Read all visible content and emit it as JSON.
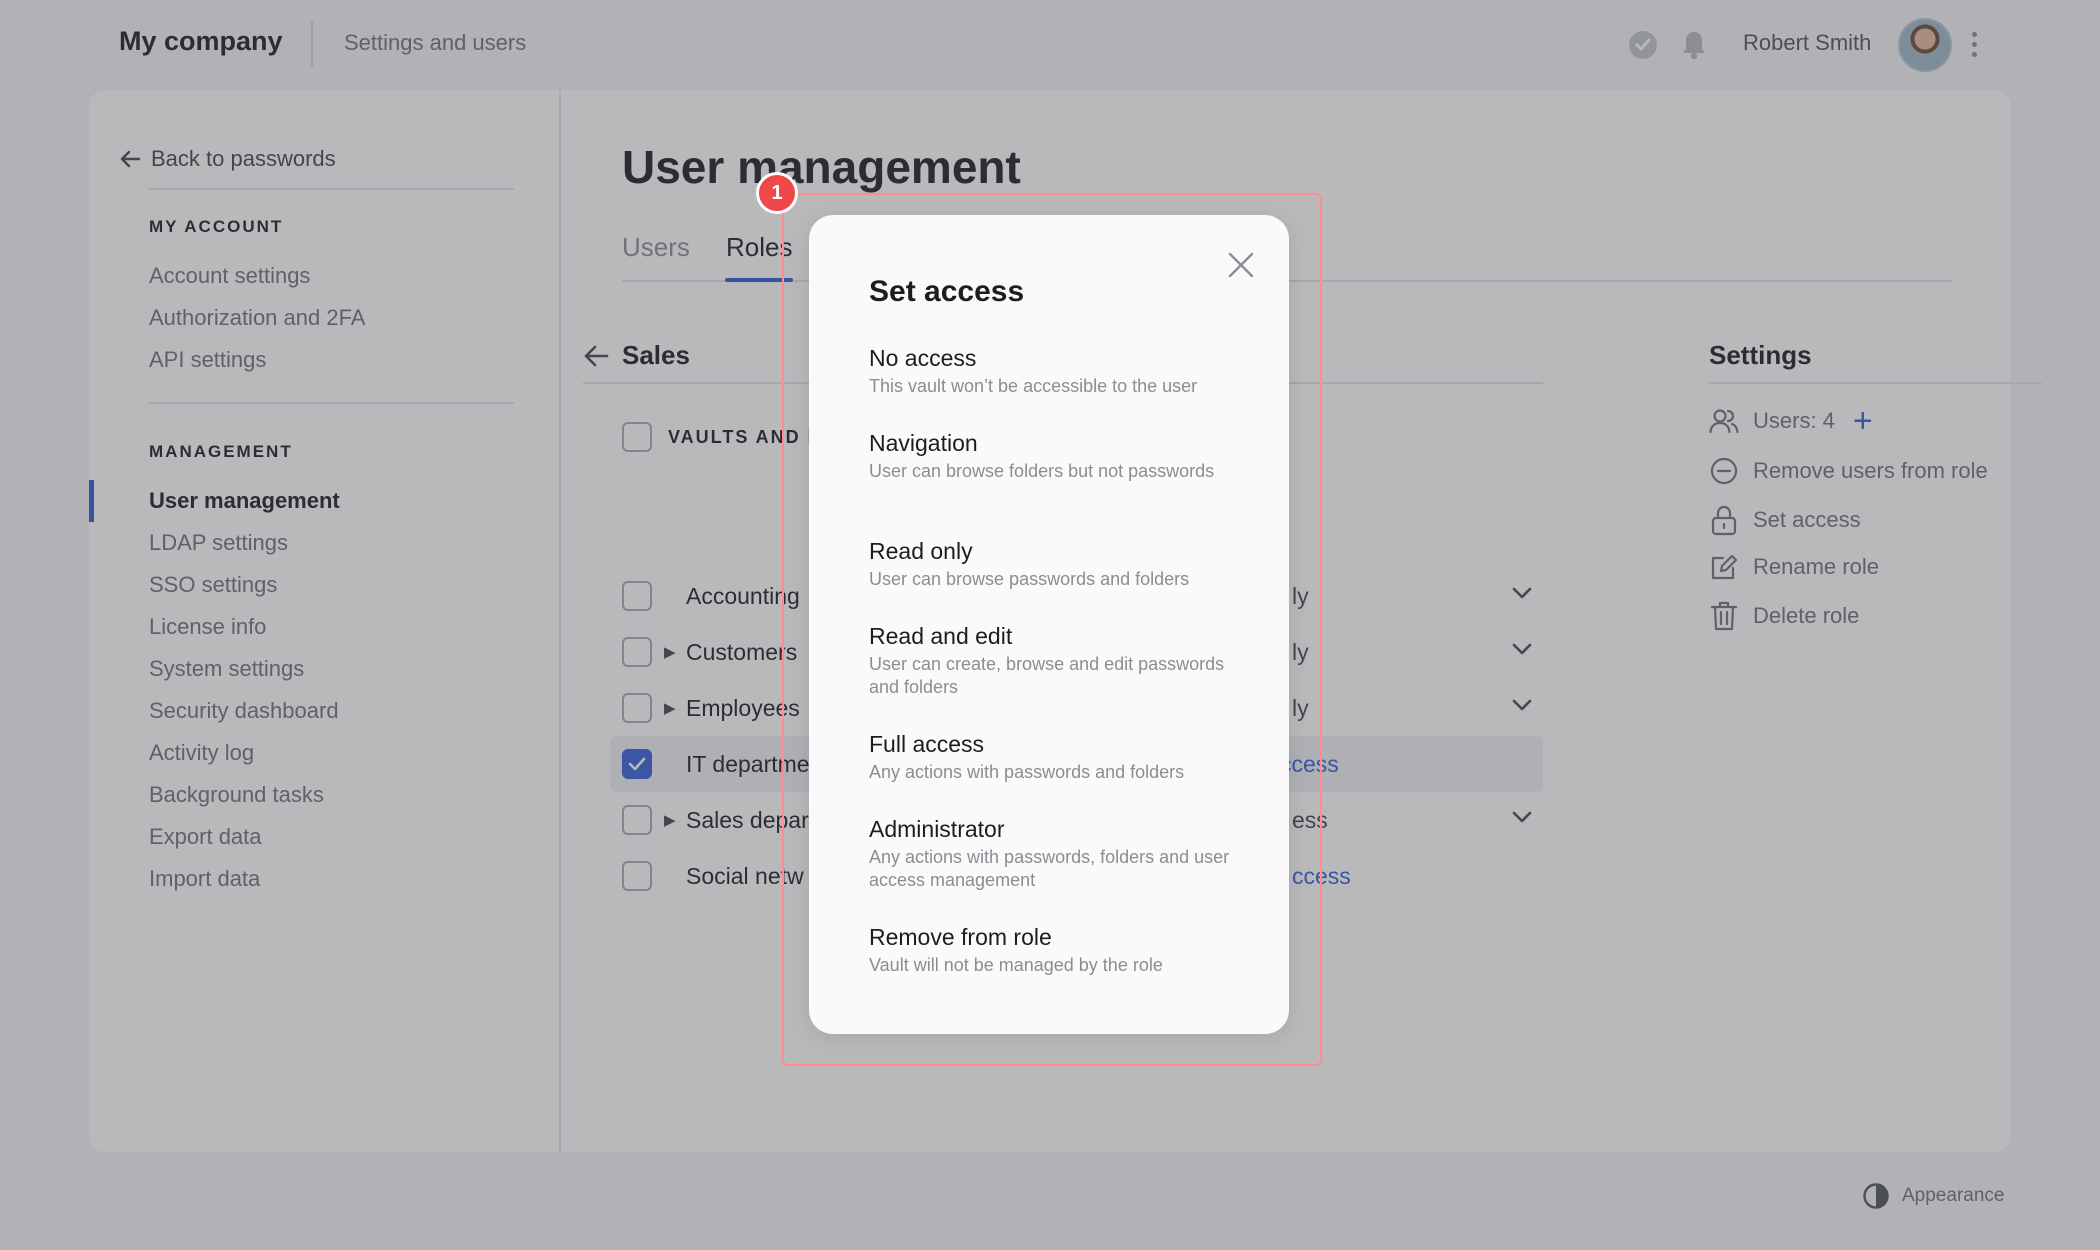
{
  "header": {
    "brand": "My company",
    "breadcrumb": "Settings and users",
    "user_name": "Robert Smith"
  },
  "sidebar": {
    "back_label": "Back to passwords",
    "my_account": {
      "heading": "MY ACCOUNT",
      "items": [
        "Account settings",
        "Authorization and 2FA",
        "API settings"
      ]
    },
    "management": {
      "heading": "MANAGEMENT",
      "items": [
        "User management",
        "LDAP settings",
        "SSO settings",
        "License info",
        "System settings",
        "Security dashboard",
        "Activity log",
        "Background tasks",
        "Export data",
        "Import data"
      ],
      "active": "User management"
    }
  },
  "main": {
    "title": "User management",
    "tabs": [
      "Users",
      "Roles"
    ],
    "active_tab": "Roles",
    "role_name": "Sales",
    "vaults_heading": "VAULTS AND I",
    "vaults": [
      {
        "name": "Accounting",
        "access": "ly",
        "expandable": false,
        "checked": false,
        "link": false,
        "dropdown": true
      },
      {
        "name": "Customers",
        "access": "ly",
        "expandable": true,
        "checked": false,
        "link": false,
        "dropdown": true
      },
      {
        "name": "Employees",
        "access": "ly",
        "expandable": true,
        "checked": false,
        "link": false,
        "dropdown": true
      },
      {
        "name": "IT departme",
        "access": "ccess",
        "expandable": false,
        "checked": true,
        "link": true,
        "dropdown": false
      },
      {
        "name": "Sales depar",
        "access": "ess",
        "expandable": true,
        "checked": false,
        "link": false,
        "dropdown": true
      },
      {
        "name": "Social netw",
        "access": "ccess",
        "expandable": false,
        "checked": false,
        "link": true,
        "dropdown": false
      }
    ]
  },
  "settings": {
    "title": "Settings",
    "users_label": "Users: 4",
    "remove_users": "Remove users from role",
    "set_access": "Set access",
    "rename_role": "Rename role",
    "delete_role": "Delete role"
  },
  "footer": {
    "appearance": "Appearance"
  },
  "annotation": {
    "badge": "1"
  },
  "modal": {
    "title": "Set access",
    "options": [
      {
        "title": "No access",
        "desc": "This vault won’t be accessible to the user"
      },
      {
        "title": "Navigation",
        "desc": "User can browse folders but not passwords"
      },
      {
        "title": "Read only",
        "desc": "User can browse passwords and folders"
      },
      {
        "title": "Read and edit",
        "desc": "User can create, browse and edit passwords and folders"
      },
      {
        "title": "Full access",
        "desc": "Any actions with passwords and folders"
      },
      {
        "title": "Administrator",
        "desc": "Any actions with passwords, folders and user access management"
      },
      {
        "title": "Remove from role",
        "desc": "Vault will not be managed by the role"
      }
    ]
  },
  "colors": {
    "accent": "#3461d8",
    "annotation": "#f04848",
    "highlight_border": "#ff8d8d"
  },
  "icons": [
    "check-circle-icon",
    "bell-icon",
    "kebab-icon",
    "arrow-left-icon",
    "chevron-down-icon",
    "users-icon",
    "plus-icon",
    "minus-circle-icon",
    "lock-icon",
    "edit-icon",
    "trash-icon",
    "contrast-icon",
    "close-icon"
  ]
}
